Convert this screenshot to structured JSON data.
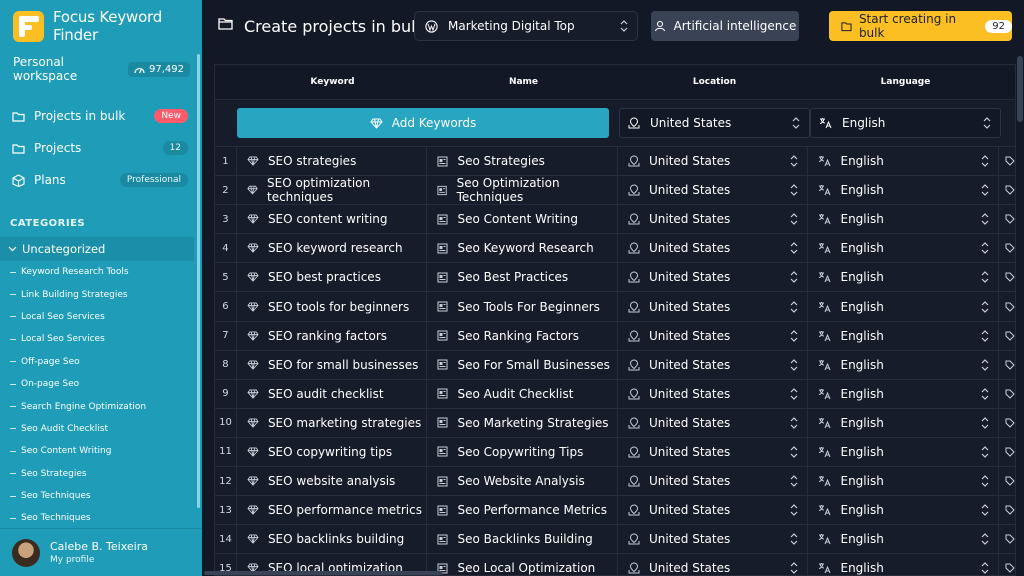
{
  "brand": {
    "title": "Focus Keyword Finder"
  },
  "workspace": {
    "label": "Personal workspace",
    "credits": "97,492"
  },
  "nav": [
    {
      "label": "Projects in bulk",
      "badge": "New",
      "icon": "folder-icon"
    },
    {
      "label": "Projects",
      "badge": "12",
      "icon": "folder-icon"
    },
    {
      "label": "Plans",
      "badge": "Professional",
      "icon": "box-icon"
    }
  ],
  "categories": {
    "header": "CATEGORIES",
    "selected": "Uncategorized",
    "items": [
      "Keyword Research Tools",
      "Link Building Strategies",
      "Local Seo Services",
      "Local Seo Services",
      "Off-page Seo",
      "On-page Seo",
      "Search Engine Optimization",
      "Seo Audit Checklist",
      "Seo Content Writing",
      "Seo Strategies",
      "Seo Techniques",
      "Seo Techniques"
    ]
  },
  "profile": {
    "name": "Calebe B. Teixeira",
    "sub": "My profile"
  },
  "topbar": {
    "title": "Create projects in bulk",
    "site_select": "Marketing Digital Top",
    "ai_button": "Artificial intelligence",
    "start_button": "Start creating in bulk",
    "start_count": "92"
  },
  "table": {
    "headers": {
      "keyword": "Keyword",
      "name": "Name",
      "location": "Location",
      "language": "Language"
    },
    "add_keywords": "Add Keywords",
    "default_location": "United States",
    "default_language": "English",
    "rows": [
      {
        "num": "1",
        "keyword": "SEO strategies",
        "name": "Seo Strategies",
        "location": "United States",
        "language": "English"
      },
      {
        "num": "2",
        "keyword": "SEO optimization techniques",
        "name": "Seo Optimization Techniques",
        "location": "United States",
        "language": "English"
      },
      {
        "num": "3",
        "keyword": "SEO content writing",
        "name": "Seo Content Writing",
        "location": "United States",
        "language": "English"
      },
      {
        "num": "4",
        "keyword": "SEO keyword research",
        "name": "Seo Keyword Research",
        "location": "United States",
        "language": "English"
      },
      {
        "num": "5",
        "keyword": "SEO best practices",
        "name": "Seo Best Practices",
        "location": "United States",
        "language": "English"
      },
      {
        "num": "6",
        "keyword": "SEO tools for beginners",
        "name": "Seo Tools For Beginners",
        "location": "United States",
        "language": "English"
      },
      {
        "num": "7",
        "keyword": "SEO ranking factors",
        "name": "Seo Ranking Factors",
        "location": "United States",
        "language": "English"
      },
      {
        "num": "8",
        "keyword": "SEO for small businesses",
        "name": "Seo For Small Businesses",
        "location": "United States",
        "language": "English"
      },
      {
        "num": "9",
        "keyword": "SEO audit checklist",
        "name": "Seo Audit Checklist",
        "location": "United States",
        "language": "English"
      },
      {
        "num": "10",
        "keyword": "SEO marketing strategies",
        "name": "Seo Marketing Strategies",
        "location": "United States",
        "language": "English"
      },
      {
        "num": "11",
        "keyword": "SEO copywriting tips",
        "name": "Seo Copywriting Tips",
        "location": "United States",
        "language": "English"
      },
      {
        "num": "12",
        "keyword": "SEO website analysis",
        "name": "Seo Website Analysis",
        "location": "United States",
        "language": "English"
      },
      {
        "num": "13",
        "keyword": "SEO performance metrics",
        "name": "Seo Performance Metrics",
        "location": "United States",
        "language": "English"
      },
      {
        "num": "14",
        "keyword": "SEO backlinks building",
        "name": "Seo Backlinks Building",
        "location": "United States",
        "language": "English"
      },
      {
        "num": "15",
        "keyword": "SEO local optimization",
        "name": "Seo Local Optimization",
        "location": "United States",
        "language": "English"
      }
    ]
  },
  "colors": {
    "sidebar": "#1f9cb8",
    "accent": "#27a5c1",
    "cta": "#fbbf24",
    "bg": "#131826"
  }
}
